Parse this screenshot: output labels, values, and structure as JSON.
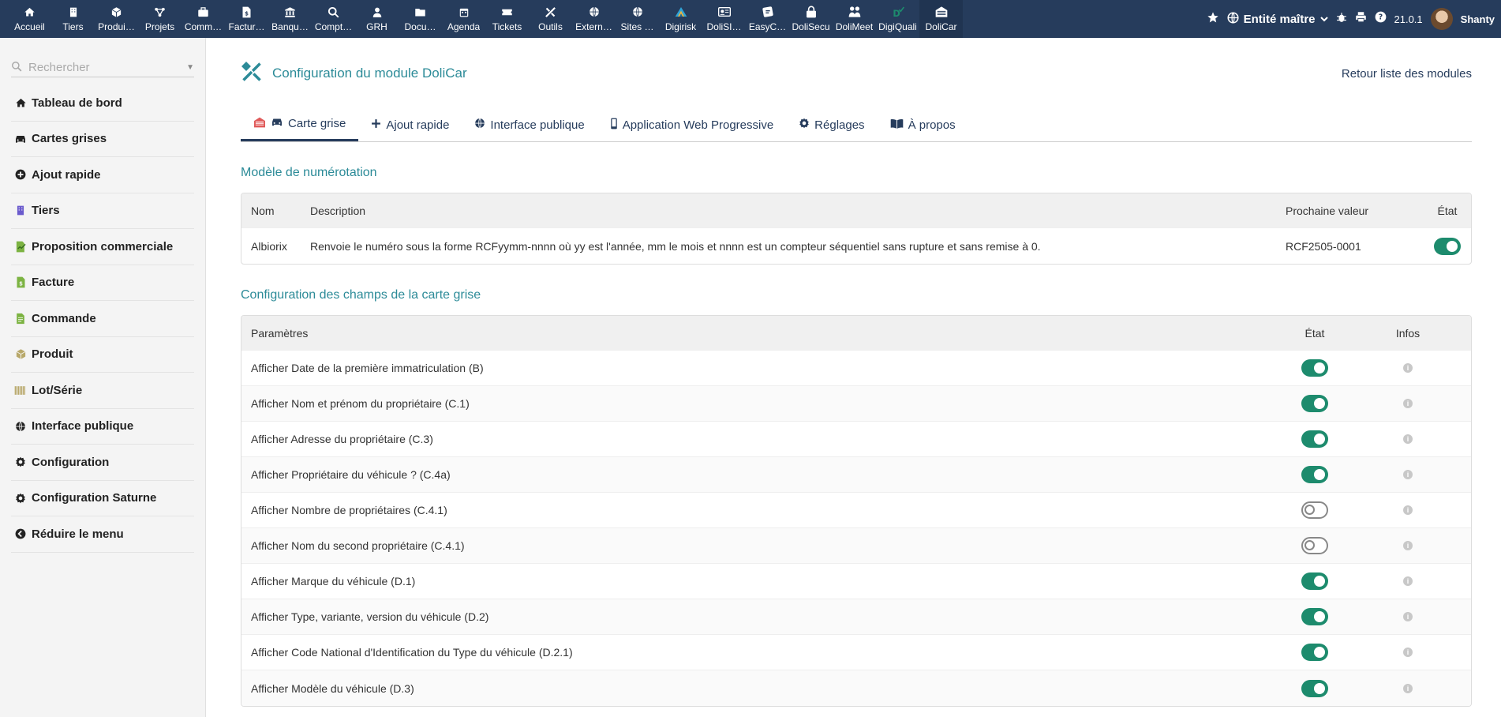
{
  "topmenu": [
    {
      "label": "Accueil",
      "icon": "home-icon"
    },
    {
      "label": "Tiers",
      "icon": "building-icon"
    },
    {
      "label": "Produi…",
      "icon": "cube-icon"
    },
    {
      "label": "Projets",
      "icon": "project-icon"
    },
    {
      "label": "Comm…",
      "icon": "briefcase-icon"
    },
    {
      "label": "Factur…",
      "icon": "invoice-icon"
    },
    {
      "label": "Banqu…",
      "icon": "bank-icon"
    },
    {
      "label": "Compt…",
      "icon": "search-dollar-icon"
    },
    {
      "label": "GRH",
      "icon": "user-tie-icon"
    },
    {
      "label": "Docu…",
      "icon": "folder-icon"
    },
    {
      "label": "Agenda",
      "icon": "calendar-icon"
    },
    {
      "label": "Tickets",
      "icon": "ticket-icon"
    },
    {
      "label": "Outils",
      "icon": "tools-icon"
    },
    {
      "label": "Extern…",
      "icon": "globe-icon"
    },
    {
      "label": "Sites …",
      "icon": "globe-icon"
    },
    {
      "label": "Digirisk",
      "icon": "digirisk-logo-icon"
    },
    {
      "label": "DoliSI…",
      "icon": "id-card-icon"
    },
    {
      "label": "EasyC…",
      "icon": "easycrm-icon"
    },
    {
      "label": "DoliSecu",
      "icon": "lock-icon"
    },
    {
      "label": "DoliMeet",
      "icon": "users-icon"
    },
    {
      "label": "DigiQuali",
      "icon": "digiquali-logo-icon"
    },
    {
      "label": "DoliCar",
      "icon": "garage-icon"
    }
  ],
  "topright": {
    "entity": "Entité maître",
    "version": "21.0.1",
    "user": "Shanty"
  },
  "sidebar": {
    "search_placeholder": "Rechercher",
    "items": [
      {
        "label": "Tableau de bord",
        "icon": "home-icon"
      },
      {
        "label": "Cartes grises",
        "icon": "car-icon"
      },
      {
        "label": "Ajout rapide",
        "icon": "plus-circle-icon"
      },
      {
        "label": "Tiers",
        "icon": "building-icon"
      },
      {
        "label": "Proposition commerciale",
        "icon": "file-signature-icon"
      },
      {
        "label": "Facture",
        "icon": "invoice-icon"
      },
      {
        "label": "Commande",
        "icon": "order-icon"
      },
      {
        "label": "Produit",
        "icon": "cube-icon"
      },
      {
        "label": "Lot/Série",
        "icon": "barcode-icon"
      },
      {
        "label": "Interface publique",
        "icon": "globe-icon"
      },
      {
        "label": "Configuration",
        "icon": "gear-icon"
      },
      {
        "label": "Configuration Saturne",
        "icon": "gear-icon"
      },
      {
        "label": "Réduire le menu",
        "icon": "chevron-circle-left-icon"
      }
    ]
  },
  "page": {
    "title": "Configuration du module DoliCar",
    "back_link": "Retour liste des modules"
  },
  "tabs": [
    {
      "label": "Carte grise",
      "active": true
    },
    {
      "label": "Ajout rapide",
      "active": false
    },
    {
      "label": "Interface publique",
      "active": false
    },
    {
      "label": "Application Web Progressive",
      "active": false
    },
    {
      "label": "Réglages",
      "active": false
    },
    {
      "label": "À propos",
      "active": false
    }
  ],
  "numbering": {
    "section_title": "Modèle de numérotation",
    "headers": {
      "nom": "Nom",
      "description": "Description",
      "next": "Prochaine valeur",
      "state": "État"
    },
    "rows": [
      {
        "nom": "Albiorix",
        "description": "Renvoie le numéro sous la forme RCFyymm-nnnn où yy est l'année, mm le mois et nnnn est un compteur séquentiel sans rupture et sans remise à 0.",
        "next": "RCF2505-0001",
        "enabled": true
      }
    ]
  },
  "fields": {
    "section_title": "Configuration des champs de la carte grise",
    "headers": {
      "param": "Paramètres",
      "state": "État",
      "info": "Infos"
    },
    "rows": [
      {
        "label": "Afficher Date de la première immatriculation (B)",
        "enabled": true
      },
      {
        "label": "Afficher Nom et prénom du propriétaire (C.1)",
        "enabled": true
      },
      {
        "label": "Afficher Adresse du propriétaire (C.3)",
        "enabled": true
      },
      {
        "label": "Afficher Propriétaire du véhicule ? (C.4a)",
        "enabled": true
      },
      {
        "label": "Afficher Nombre de propriétaires (C.4.1)",
        "enabled": false
      },
      {
        "label": "Afficher Nom du second propriétaire (C.4.1)",
        "enabled": false
      },
      {
        "label": "Afficher Marque du véhicule (D.1)",
        "enabled": true
      },
      {
        "label": "Afficher Type, variante, version du véhicule (D.2)",
        "enabled": true
      },
      {
        "label": "Afficher Code National d'Identification du Type du véhicule (D.2.1)",
        "enabled": true
      },
      {
        "label": "Afficher Modèle du véhicule (D.3)",
        "enabled": true
      }
    ]
  },
  "colors": {
    "topbar": "#263c5c",
    "accent": "#2c8b98",
    "toggle_on": "#1d8b6d"
  }
}
